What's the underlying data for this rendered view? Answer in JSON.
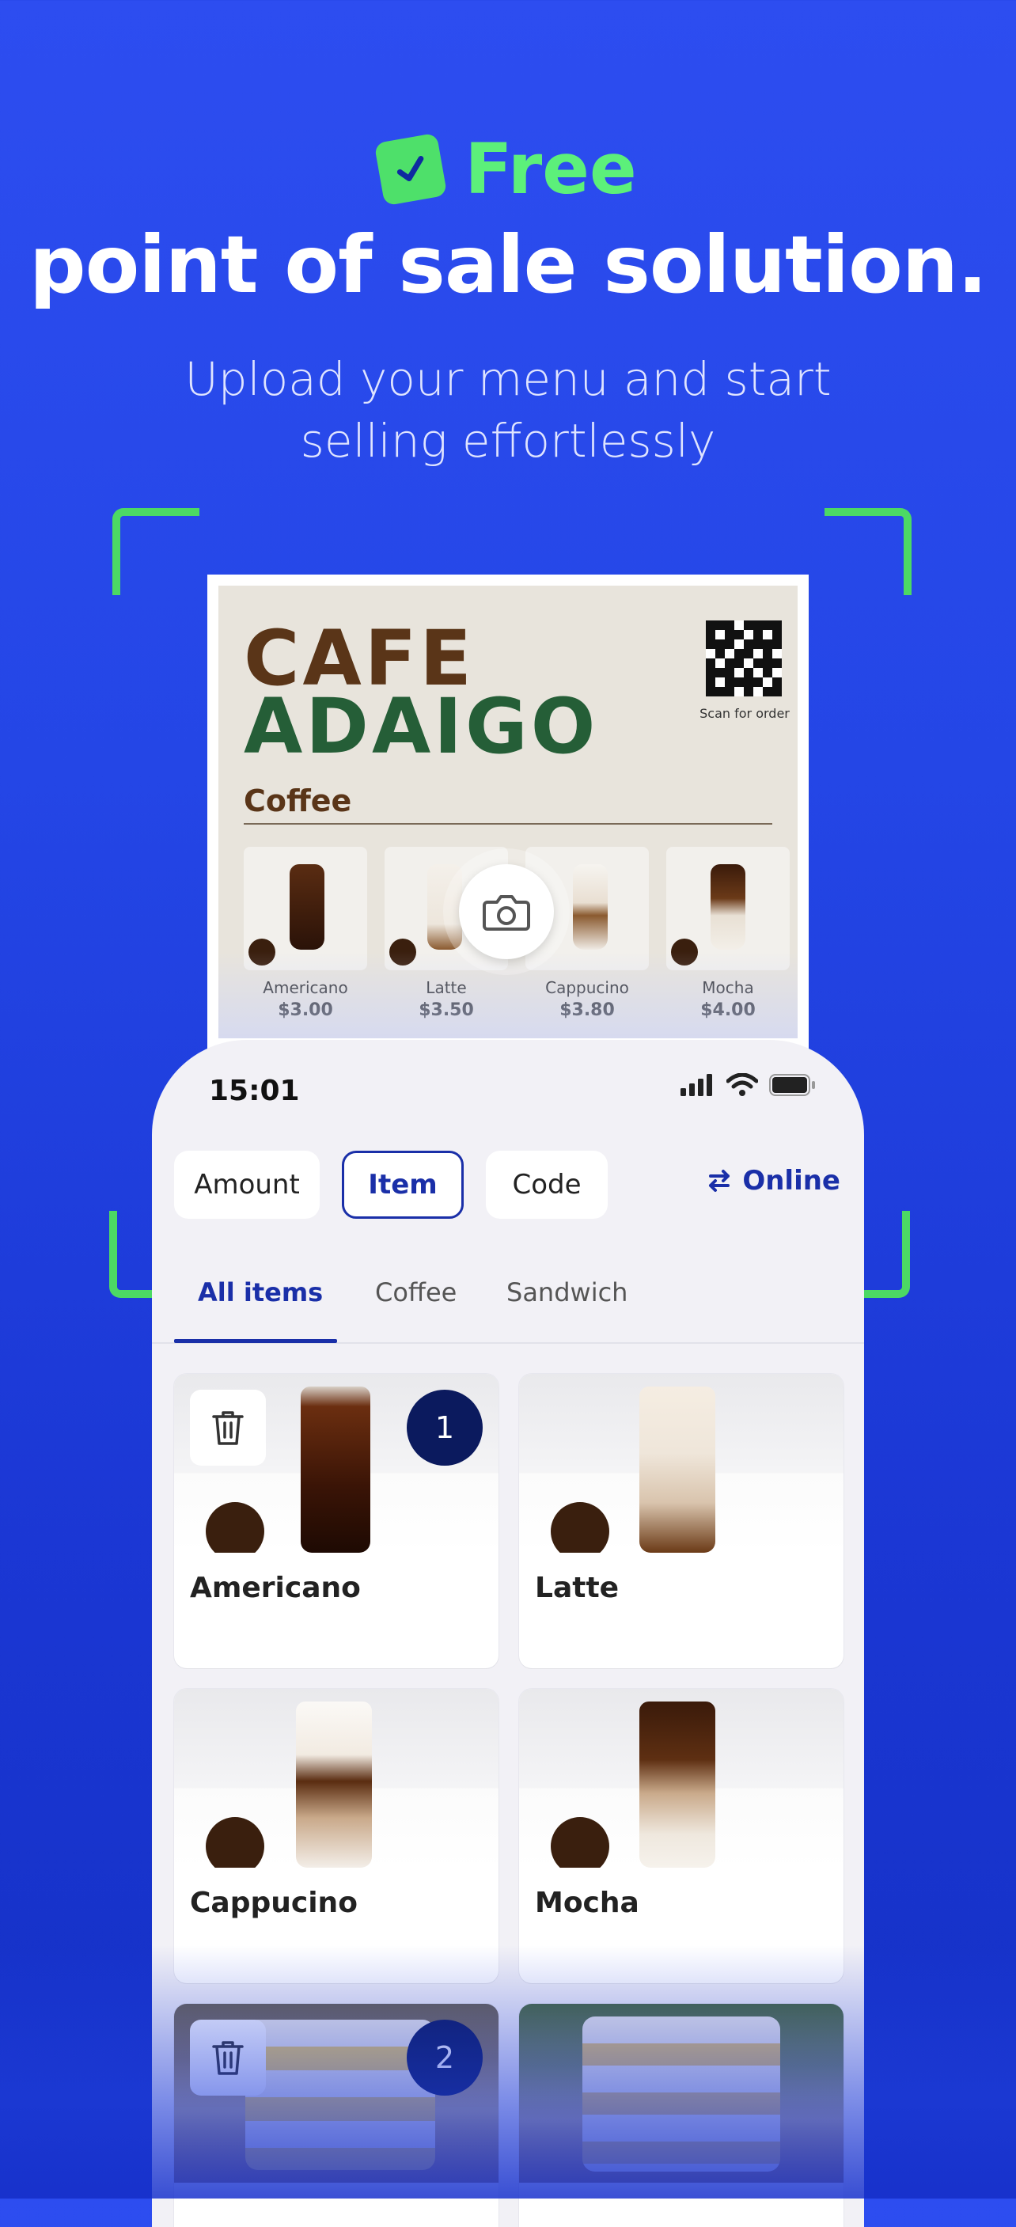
{
  "hero": {
    "badge_word": "Free",
    "title": "point of sale solution.",
    "subtitle": "Upload your menu and start selling effortlessly"
  },
  "paper_menu": {
    "brand_line1": "CAFE",
    "brand_line2": "ADAIGO",
    "scan_label": "Scan for order",
    "section": "Coffee",
    "items": [
      {
        "name": "Americano",
        "price": "$3.00"
      },
      {
        "name": "Latte",
        "price": "$3.50"
      },
      {
        "name": "Cappucino",
        "price": "$3.80"
      },
      {
        "name": "Mocha",
        "price": "$4.00"
      }
    ]
  },
  "phone": {
    "status_time": "15:01",
    "modes": [
      "Amount",
      "Item",
      "Code"
    ],
    "active_mode": "Item",
    "online_label": "Online",
    "tabs": [
      "All items",
      "Coffee",
      "Sandwich"
    ],
    "active_tab": "All items",
    "products": [
      {
        "name": "Americano",
        "count": "1"
      },
      {
        "name": "Latte"
      },
      {
        "name": "Cappucino"
      },
      {
        "name": "Mocha"
      },
      {
        "name": "",
        "count": "2"
      },
      {
        "name": ""
      }
    ]
  },
  "colors": {
    "background": "#2446e6",
    "accent_green": "#5cf07a",
    "brand_navy": "#1a2fa8",
    "badge_navy": "#0b1a5e"
  },
  "icons": [
    "check-icon",
    "camera-icon",
    "signal-icon",
    "wifi-icon",
    "battery-icon",
    "swap-arrows-icon",
    "trash-icon"
  ]
}
